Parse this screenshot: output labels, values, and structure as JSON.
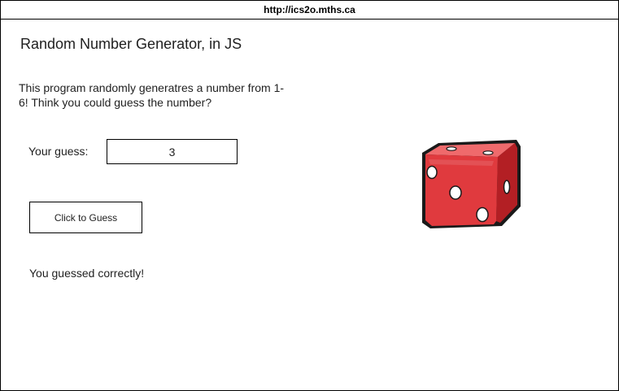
{
  "browser": {
    "url": "http://ics2o.mths.ca"
  },
  "page": {
    "title": "Random Number Generator, in JS",
    "description": "This program randomly generatres a number from 1-6! Think you could guess the number?"
  },
  "form": {
    "guess_label": "Your guess:",
    "guess_value": "3",
    "button_label": "Click to Guess"
  },
  "result": {
    "message": "You guessed correctly!"
  },
  "image": {
    "icon": "dice-icon",
    "colors": {
      "face": "#e03a3e",
      "top": "#ef6a6c",
      "side": "#b31f24",
      "pip": "#ffffff"
    }
  }
}
